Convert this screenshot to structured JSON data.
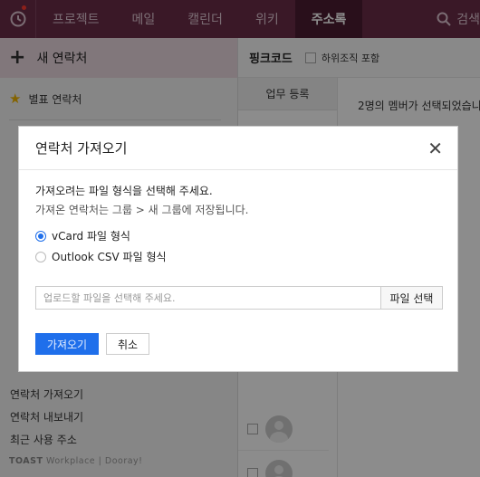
{
  "nav": {
    "items": [
      "프로젝트",
      "메일",
      "캘린더",
      "위키",
      "주소록"
    ],
    "active_index": 4,
    "search_label": "검색"
  },
  "sidebar": {
    "new_contact": "새 연락처",
    "favorites": "별표 연락처",
    "bottom_links": [
      "연락처 가져오기",
      "연락처 내보내기",
      "최근 사용 주소"
    ],
    "logo": {
      "brand": "TOAST",
      "product": "Workplace",
      "service": "Dooray!"
    }
  },
  "main": {
    "title": "핑크코드",
    "include_subgroups": "하위조직 포함",
    "column_header": "업무 등록",
    "selection_message": "2명의 멤버가 선택되었습니다"
  },
  "modal": {
    "title": "연락처 가져오기",
    "question": "가져오려는 파일 형식을 선택해 주세요.",
    "info": "가져온 연락처는 그룹 > 새 그룹에 저장됩니다.",
    "options": [
      "vCard 파일 형식",
      "Outlook CSV 파일 형식"
    ],
    "selected_option": 0,
    "file_placeholder": "업로드할 파일을 선택해 주세요.",
    "file_button": "파일 선택",
    "import_button": "가져오기",
    "cancel_button": "취소"
  },
  "colors": {
    "nav_bg": "#6a2c48",
    "accent_blue": "#1f6feb",
    "new_contact_bg": "#ecd9e1"
  }
}
